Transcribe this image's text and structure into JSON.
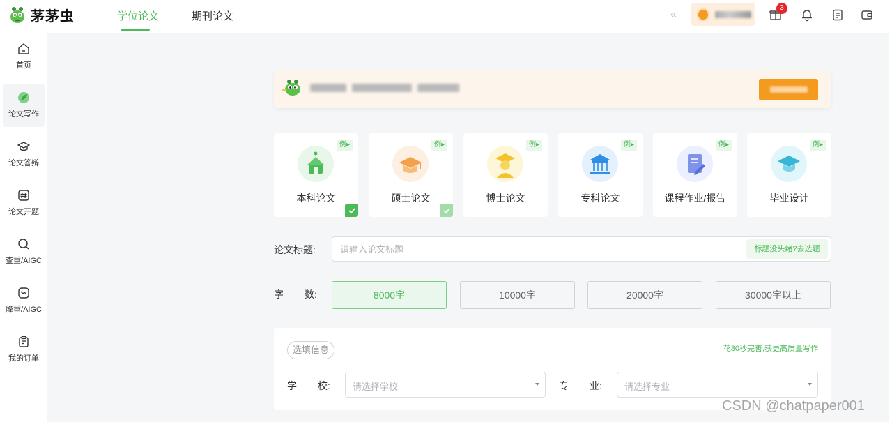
{
  "app": {
    "name": "茅茅虫",
    "accent_color": "#4cba58"
  },
  "header": {
    "tabs": [
      {
        "label": "学位论文",
        "active": true
      },
      {
        "label": "期刊论文",
        "active": false
      }
    ],
    "collapse_glyph": "«",
    "notification_badge": "3",
    "icons": [
      "gift-icon",
      "bell-icon",
      "clipboard-icon",
      "wallet-icon"
    ]
  },
  "sidebar": {
    "items": [
      {
        "label": "首页",
        "icon": "home-icon",
        "active": false
      },
      {
        "label": "论文写作",
        "icon": "leaf-icon",
        "active": true
      },
      {
        "label": "论文答辩",
        "icon": "graduation-cap-icon",
        "active": false
      },
      {
        "label": "论文开题",
        "icon": "hash-icon",
        "active": false
      },
      {
        "label": "查重/AIGC",
        "icon": "search-icon",
        "active": false
      },
      {
        "label": "降重/AIGC",
        "icon": "trend-down-icon",
        "active": false
      },
      {
        "label": "我的订单",
        "icon": "order-list-icon",
        "active": false
      }
    ]
  },
  "paper_types": [
    {
      "label": "本科论文",
      "tag": "例▸",
      "selected": true
    },
    {
      "label": "硕士论文",
      "tag": "例▸",
      "selected": true
    },
    {
      "label": "博士论文",
      "tag": "例▸",
      "selected": false
    },
    {
      "label": "专科论文",
      "tag": "例▸",
      "selected": false
    },
    {
      "label": "课程作业/报告",
      "tag": "例▸",
      "selected": false
    },
    {
      "label": "毕业设计",
      "tag": "例▸",
      "selected": false
    }
  ],
  "form": {
    "title_label": "论文标题:",
    "title_placeholder": "请输入论文标题",
    "title_value": "",
    "title_hint": "标题没头绪?去选题",
    "count_label_a": "字",
    "count_label_b": "数:",
    "word_counts": [
      {
        "label": "8000字",
        "active": true
      },
      {
        "label": "10000字",
        "active": false
      },
      {
        "label": "20000字",
        "active": false
      },
      {
        "label": "30000字以上",
        "active": false
      }
    ]
  },
  "optional": {
    "pill": "选填信息",
    "hint": "花30秒完善,获更高质量写作",
    "school_label_a": "学",
    "school_label_b": "校:",
    "school_placeholder": "请选择学校",
    "major_label_a": "专",
    "major_label_b": "业:",
    "major_placeholder": "请选择专业"
  },
  "watermark": "CSDN @chatpaper001"
}
